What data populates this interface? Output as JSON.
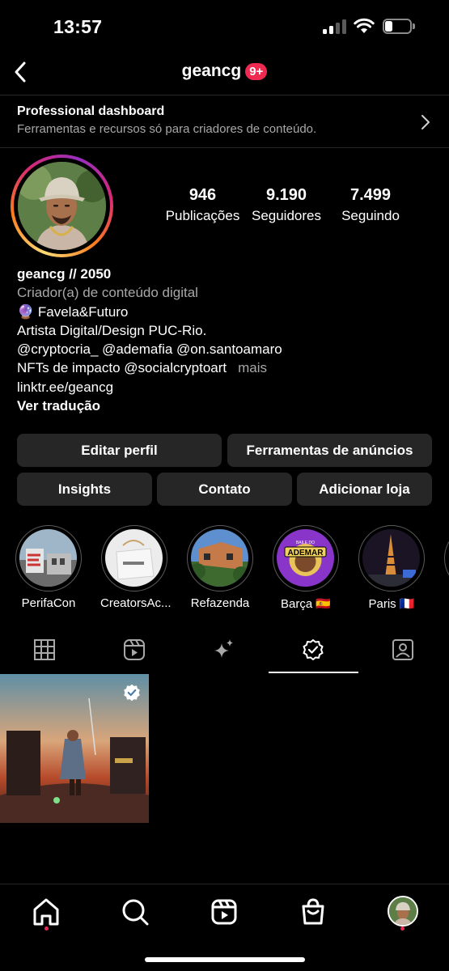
{
  "status_bar": {
    "time": "13:57"
  },
  "header": {
    "username": "geancg",
    "notification_badge": "9+"
  },
  "dashboard": {
    "title": "Professional dashboard",
    "subtitle": "Ferramentas e recursos só para criadores de conteúdo."
  },
  "stats": {
    "posts": {
      "value": "946",
      "label": "Publicações"
    },
    "followers": {
      "value": "9.190",
      "label": "Seguidores"
    },
    "following": {
      "value": "7.499",
      "label": "Seguindo"
    }
  },
  "bio": {
    "name": "geancg // 2050",
    "category": "Criador(a) de conteúdo digital",
    "line1": "🔮 Favela&Futuro",
    "line2": "Artista Digital/Design PUC-Rio.",
    "line3": "@cryptocria_ @ademafia @on.santoamaro",
    "line4": "NFTs de impacto @socialcryptoart",
    "more": "mais",
    "link": "linktr.ee/geancg",
    "translate": "Ver tradução"
  },
  "buttons": {
    "edit_profile": "Editar perfil",
    "ad_tools": "Ferramentas de anúncios",
    "insights": "Insights",
    "contact": "Contato",
    "add_shop": "Adicionar loja"
  },
  "highlights": [
    {
      "label": "PerifaCon"
    },
    {
      "label": "CreatorsAc..."
    },
    {
      "label": "Refazenda"
    },
    {
      "label": "Barça 🇪🇸"
    },
    {
      "label": "Paris 🇫🇷"
    }
  ],
  "highlight_text": {
    "ademar_top": "BAILE DO",
    "ademar_main": "ADEMAR"
  },
  "tabs": [
    "grid-icon",
    "reels-icon",
    "sparkles-icon",
    "guides-check-icon",
    "tagged-icon"
  ],
  "active_tab": "guides-check-icon",
  "colors": {
    "background": "#000000",
    "button": "#262626",
    "badge": "#ee2a52",
    "muted": "#a8a8a8"
  }
}
